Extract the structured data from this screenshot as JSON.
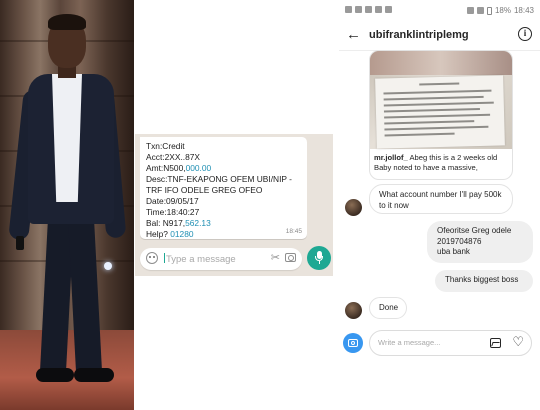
{
  "whatsapp": {
    "sms_lines": [
      {
        "text": "Txn:Credit"
      },
      {
        "text": "Acct:2XX..87X"
      },
      {
        "prefix": "Amt:N500,",
        "highlight": "000.00"
      },
      {
        "text": "Desc:TNF-EKAPONG OFEM UBI/NIP -"
      },
      {
        "text": "TRF IFO ODELE GREG OFEO"
      },
      {
        "text": "Date:09/05/17"
      },
      {
        "text": "Time:18:40:27"
      },
      {
        "prefix": "Bal: N917,",
        "highlight": "562.13"
      },
      {
        "prefix": "Help? ",
        "highlight": "01280"
      }
    ],
    "time": "18:45",
    "input_placeholder": "Type a message",
    "accent": "#1ea893",
    "link_color": "#1f8fb3"
  },
  "instagram": {
    "status_bar": {
      "battery": "18%",
      "time": "18:43"
    },
    "header": {
      "username": "ubifranklintriplemg",
      "info": "i"
    },
    "shared_post": {
      "author": "mr.jollof_",
      "caption": " Abeg this is a 2 weeks old Baby noted to have a massive,"
    },
    "messages": [
      {
        "from": "them",
        "text": "What account number I'll pay 500k to it now"
      },
      {
        "from": "me",
        "lines": [
          "Ofeoritse Greg odele",
          "2019704876",
          "uba bank"
        ]
      },
      {
        "from": "me",
        "lines": [
          "Thanks biggest boss"
        ]
      },
      {
        "from": "them",
        "text": "Done"
      }
    ],
    "composer_placeholder": "Write a message...",
    "accent": "#3897f0"
  }
}
